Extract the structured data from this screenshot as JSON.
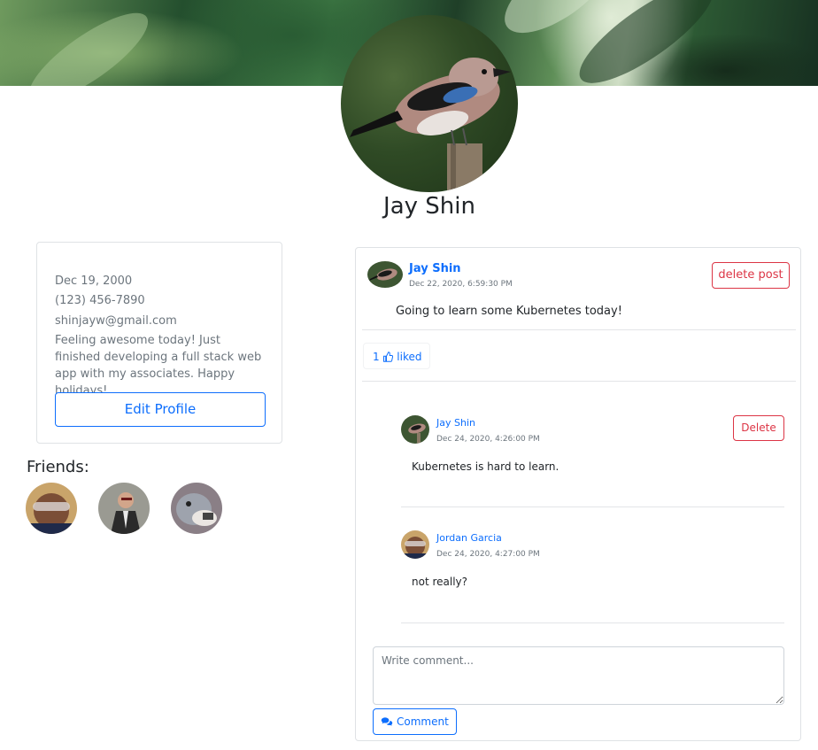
{
  "profile": {
    "name": "Jay Shin",
    "birthday": "Dec 19, 2000",
    "phone": "(123) 456-7890",
    "email": "shinjayw@gmail.com",
    "bio": "Feeling awesome today! Just finished developing a full stack web app with my associates. Happy holidays!",
    "edit_label": "Edit Profile"
  },
  "friends": {
    "title": "Friends:",
    "items": [
      {
        "name": "friend-1"
      },
      {
        "name": "friend-2"
      },
      {
        "name": "friend-3"
      }
    ]
  },
  "post": {
    "author": "Jay Shin",
    "date": "Dec 22, 2020, 6:59:30 PM",
    "delete_label": "delete post",
    "text": "Going to learn some Kubernetes today!",
    "likes_count": "1",
    "liked_label": "liked",
    "comments": [
      {
        "author": "Jay Shin",
        "date": "Dec 24, 2020, 4:26:00 PM",
        "text": "Kubernetes is hard to learn.",
        "delete_label": "Delete"
      },
      {
        "author": "Jordan Garcia",
        "date": "Dec 24, 2020, 4:27:00 PM",
        "text": "not really?"
      }
    ],
    "comment_placeholder": "Write comment...",
    "comment_button_label": "Comment"
  },
  "icons": {
    "like": "thumbs-up-icon",
    "comment": "comments-icon"
  },
  "colors": {
    "primary": "#0d6efd",
    "danger": "#dc3545",
    "muted": "#6c757d"
  }
}
